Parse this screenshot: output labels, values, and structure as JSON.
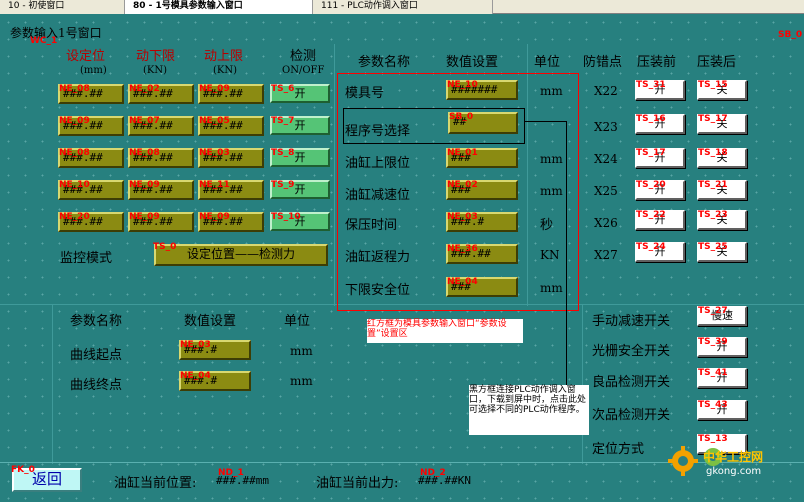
{
  "tabs": [
    {
      "label": "10 - 初使窗口"
    },
    {
      "label": "80 - 1号模具参数输入窗口"
    },
    {
      "label": "111 - PLC动作调入窗口"
    }
  ],
  "window": {
    "title": "参数输入1号窗口",
    "tag_left": "WC_1",
    "tag_right": "SB_0"
  },
  "left_headers": {
    "col1": "设定位",
    "col1_unit": "(mm)",
    "col2": "动下限",
    "col2_unit": "(KN)",
    "col3": "动上限",
    "col3_unit": "(KN)",
    "col4": "检测",
    "col4_unit": "ON/OFF"
  },
  "left_rows": [
    {
      "f1": "###.##",
      "f2": "###.##",
      "f3": "###.##",
      "t1": "NE_08",
      "t2": "NE_02",
      "t3": "NE_09",
      "tsw": "TS_6",
      "sw": "开"
    },
    {
      "f1": "###.##",
      "f2": "###.##",
      "f3": "###.##",
      "t1": "NE_09",
      "t2": "NE_07",
      "t3": "NE_05",
      "tsw": "TS_7",
      "sw": "开"
    },
    {
      "f1": "###.##",
      "f2": "###.##",
      "f3": "###.##",
      "t1": "NE_08",
      "t2": "NE_08",
      "t3": "NE_03",
      "tsw": "TS_8",
      "sw": "开"
    },
    {
      "f1": "###.##",
      "f2": "###.##",
      "f3": "###.##",
      "t1": "NE_10",
      "t2": "NE_09",
      "t3": "NE_11",
      "tsw": "TS_9",
      "sw": "开"
    },
    {
      "f1": "###.##",
      "f2": "###.##",
      "f3": "###.##",
      "t1": "NE_20",
      "t2": "NE_09",
      "t3": "NE_09",
      "tsw": "TS_10",
      "sw": "开"
    }
  ],
  "monitor": {
    "label": "监控模式",
    "tag": "TS_0",
    "button": "设定位置——检测力"
  },
  "right_headers": {
    "name": "参数名称",
    "value": "数值设置",
    "unit": "单位",
    "guard": "防错点",
    "before": "压装前",
    "after": "压装后"
  },
  "right_rows": [
    {
      "name": "模具号",
      "value": "#######",
      "vtag": "NE_10",
      "unit": "mm",
      "guard": "X22",
      "btag": "TS_31",
      "bval": "开",
      "atag": "TS_15",
      "aval": "关"
    },
    {
      "name": "程序号选择",
      "value": "##",
      "vtag": "SB_0",
      "unit": "",
      "guard": "X23",
      "btag": "TS_16",
      "bval": "开",
      "atag": "TS_17",
      "aval": "关"
    },
    {
      "name": "油缸上限位",
      "value": "###",
      "vtag": "NE_01",
      "unit": "mm",
      "guard": "X24",
      "btag": "TS_17",
      "bval": "开",
      "atag": "TS_18",
      "aval": "关"
    },
    {
      "name": "油缸减速位",
      "value": "###",
      "vtag": "NE_02",
      "unit": "mm",
      "guard": "X25",
      "btag": "TS_20",
      "bval": "开",
      "atag": "TS_21",
      "aval": "关"
    },
    {
      "name": "保压时间",
      "value": "###.#",
      "vtag": "NE_03",
      "unit": "秒",
      "guard": "X26",
      "btag": "TS_22",
      "bval": "开",
      "atag": "TS_23",
      "aval": "关"
    },
    {
      "name": "油缸返程力",
      "value": "###.##",
      "vtag": "NE_36",
      "unit": "KN",
      "guard": "X27",
      "btag": "TS_24",
      "bval": "开",
      "atag": "TS_25",
      "aval": "关"
    },
    {
      "name": "下限安全位",
      "value": "###",
      "vtag": "NE_04",
      "unit": "mm",
      "guard": "",
      "btag": "",
      "bval": "",
      "atag": "",
      "aval": ""
    }
  ],
  "curve": {
    "headers": {
      "name": "参数名称",
      "value": "数值设置",
      "unit": "单位"
    },
    "rows": [
      {
        "name": "曲线起点",
        "value": "###.#",
        "tag": "NE_03",
        "unit": "mm"
      },
      {
        "name": "曲线终点",
        "value": "###.#",
        "tag": "NE_04",
        "unit": "mm"
      }
    ]
  },
  "switches": [
    {
      "label": "手动减速开关",
      "tag": "TS_27",
      "value": "慢速"
    },
    {
      "label": "光栅安全开关",
      "tag": "TS_39",
      "value": "开"
    },
    {
      "label": "良品检测开关",
      "tag": "TS_41",
      "value": "开"
    },
    {
      "label": "次品检测开关",
      "tag": "TS_43",
      "value": "开"
    },
    {
      "label": "定位方式",
      "tag": "TS_13",
      "value": ""
    }
  ],
  "notes": {
    "red": "红方框为模具参数输入窗口“参数设置”设置区",
    "black": "黑方框连接PLC动作调入窗口，下载到屏中时，点击此处可选择不同的PLC动作程序。"
  },
  "footer": {
    "back_tag": "FK_0",
    "back": "返回",
    "pos_label": "油缸当前位置:",
    "pos_tag": "ND_1",
    "pos_value": "###.##mm",
    "force_label": "油缸当前出力:",
    "force_tag": "ND_2",
    "force_value": "###.##KN"
  },
  "watermark": {
    "text": "中华工控网",
    "url": "gkong.com"
  },
  "colors": {
    "panel": "#27807f",
    "field": "#8b8b12",
    "switch_green": "#55c476",
    "tag_red": "#ff0000"
  }
}
